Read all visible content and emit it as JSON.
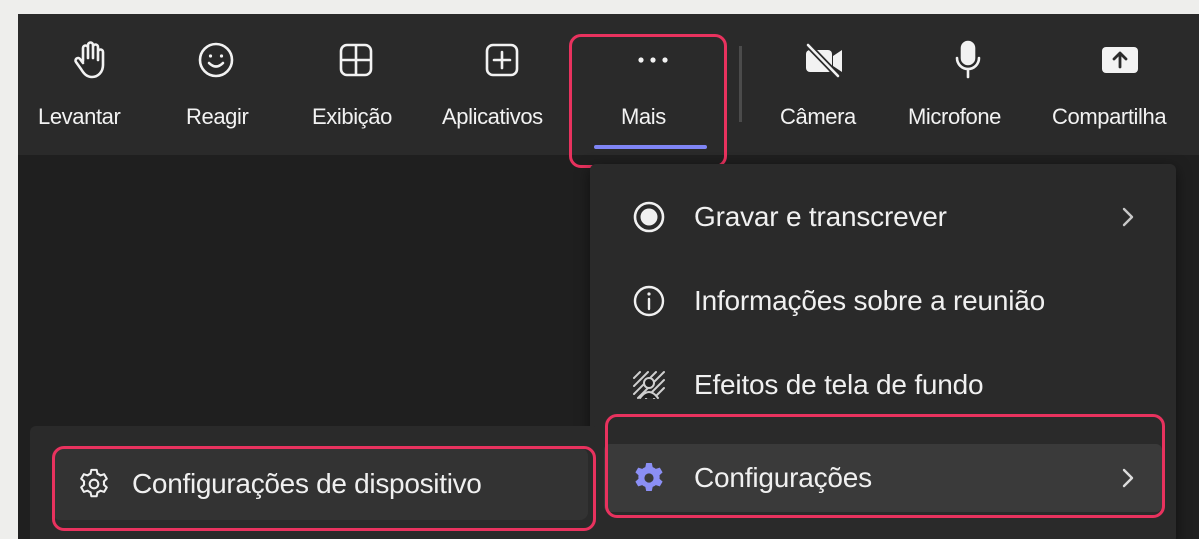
{
  "toolbar": {
    "items": [
      {
        "label": "Levantar",
        "icon": "raise-hand-icon"
      },
      {
        "label": "Reagir",
        "icon": "smiley-icon"
      },
      {
        "label": "Exibição",
        "icon": "grid-layout-icon"
      },
      {
        "label": "Aplicativos",
        "icon": "add-app-icon"
      },
      {
        "label": "Mais",
        "icon": "more-dots-icon"
      },
      {
        "label": "Câmera",
        "icon": "camera-off-icon"
      },
      {
        "label": "Microfone",
        "icon": "microphone-icon"
      },
      {
        "label": "Compartilha",
        "icon": "share-screen-icon"
      }
    ]
  },
  "more_menu": {
    "items": [
      {
        "label": "Gravar e transcrever",
        "icon": "record-icon",
        "has_submenu": true
      },
      {
        "label": "Informações sobre a reunião",
        "icon": "info-icon",
        "has_submenu": false
      },
      {
        "label": "Efeitos de tela de fundo",
        "icon": "background-effects-icon",
        "has_submenu": false
      },
      {
        "label": "Configurações",
        "icon": "gear-icon",
        "has_submenu": true
      }
    ]
  },
  "settings_submenu": {
    "items": [
      {
        "label": "Configurações de dispositivo",
        "icon": "gear-outline-icon"
      }
    ]
  },
  "colors": {
    "highlight": "#e8325e",
    "accent": "#7f85f5",
    "toolbar_bg": "#2a2a2a",
    "stage_bg": "#1f1f1f"
  }
}
